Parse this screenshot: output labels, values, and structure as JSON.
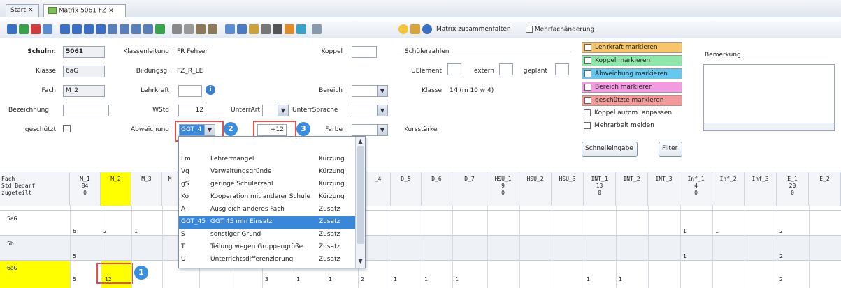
{
  "tabs": [
    {
      "label": "Start"
    },
    {
      "label": "Matrix 5061 FZ"
    }
  ],
  "toolbar": {
    "collapse_label": "Matrix zusammenfalten",
    "multi_label": "Mehrfachänderung"
  },
  "form": {
    "schulnr_label": "Schulnr.",
    "schulnr_value": "5061",
    "klasse_label": "Klasse",
    "klasse_value": "6aG",
    "fach_label": "Fach",
    "fach_value": "M_2",
    "bez_label": "Bezeichnung",
    "bez_value": "",
    "geschuetzt_label": "geschützt",
    "kl_label": "Klassenleitung",
    "kl_value": "FR Fehser",
    "bg_label": "Bildungsg.",
    "bg_value": "FZ_R_LE",
    "lk_label": "Lehrkraft",
    "lk_value": "",
    "wstd_label": "WStd",
    "wstd_value": "12",
    "unterrart_label": "UnterrArt",
    "abw_label": "Abweichung",
    "abw_value": "GGT_4",
    "koppel_label": "Koppel",
    "bereich_label": "Bereich",
    "untersprache_label": "UnterrSprache",
    "plus_value": "+12",
    "farbe_label": "Farbe",
    "schueler_label": "Schülerzahlen",
    "uel_label": "UElement",
    "extern_label": "extern",
    "geplant_label": "geplant",
    "klasse2_label": "Klasse",
    "klasse2_value": "14 (m 10 w 4)",
    "kursstaerke_label": "Kursstärke",
    "bemerkung_label": "Bemerkung"
  },
  "marks": [
    {
      "label": "Lehrkraft markieren",
      "color": "#f9c56a"
    },
    {
      "label": "Koppel markieren",
      "color": "#8ee6a8"
    },
    {
      "label": "Abweichung markieren",
      "color": "#67c8ef"
    },
    {
      "label": "Bereich markieren",
      "color": "#f29be3"
    },
    {
      "label": "geschützte markieren",
      "color": "#f29a9a"
    },
    {
      "label": "Koppel autom. anpassen",
      "color": "#ffffff"
    },
    {
      "label": "Mehrarbeit melden",
      "color": "#ffffff"
    }
  ],
  "buttons": {
    "schnell": "Schnelleingabe",
    "filter": "Filter"
  },
  "callouts": [
    "1",
    "2",
    "3"
  ],
  "grid": {
    "rowhead": "Fach\nStd Bedarf\nzugeteilt",
    "cols": [
      {
        "h": "M_1\n84\n0"
      },
      {
        "h": "M_2"
      },
      {
        "h": "M_3"
      },
      {
        "h": "M"
      },
      {
        "h": "_4"
      },
      {
        "h": "D_5"
      },
      {
        "h": "D_6"
      },
      {
        "h": "D_7"
      },
      {
        "h": "HSU_1\n9\n0"
      },
      {
        "h": "HSU_2"
      },
      {
        "h": "HSU_3"
      },
      {
        "h": "INT_1\n13\n0"
      },
      {
        "h": "INT_2"
      },
      {
        "h": "INT_3"
      },
      {
        "h": "Inf_1\n4\n0"
      },
      {
        "h": "Inf_2"
      },
      {
        "h": "Inf_3"
      },
      {
        "h": "E_1\n20\n0"
      },
      {
        "h": "E_2"
      }
    ],
    "rows": [
      {
        "label": "5aG",
        "m1": "6",
        "m2": "2",
        "m3": "1",
        "inf1": "1",
        "inf2": "1",
        "e1": "2"
      },
      {
        "label": "5b",
        "m1": "5",
        "inf1": "1",
        "e1": "2"
      },
      {
        "label": "6aG",
        "m1": "5",
        "m2": "12",
        "v5": "3",
        "v6": "1",
        "v7": "1",
        "v8": "2",
        "v9": "1",
        "v10": "1",
        "v11": "1",
        "int1": "1",
        "int2": "1",
        "e1": "2"
      }
    ]
  },
  "dropdown": [
    {
      "code": "Lm",
      "text": "Lehrermangel",
      "type": "Kürzung"
    },
    {
      "code": "Vg",
      "text": "Verwaltungsgründe",
      "type": "Kürzung"
    },
    {
      "code": "gS",
      "text": "geringe Schülerzahl",
      "type": "Kürzung"
    },
    {
      "code": "Ko",
      "text": "Kooperation mit anderer Schule",
      "type": "Kürzung"
    },
    {
      "code": "A",
      "text": "Ausgleich anderes Fach",
      "type": "Zusatz"
    },
    {
      "code": "GGT_45",
      "text": "GGT 45 min Einsatz",
      "type": "Zusatz"
    },
    {
      "code": "S",
      "text": "sonstiger Grund",
      "type": "Zusatz"
    },
    {
      "code": "T",
      "text": "Teilung wegen Gruppengröße",
      "type": "Zusatz"
    },
    {
      "code": "U",
      "text": "Unterrichtsdifferenzierung",
      "type": "Zusatz"
    }
  ]
}
